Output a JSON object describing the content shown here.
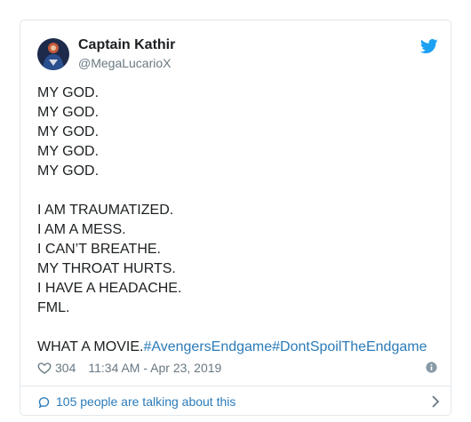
{
  "tweet": {
    "author_name": "Captain Kathir",
    "author_handle": "@MegaLucarioX",
    "lines": [
      "MY GOD.",
      "MY GOD.",
      "MY GOD.",
      "MY GOD.",
      "MY GOD.",
      "",
      "I AM TRAUMATIZED.",
      "I AM A MESS.",
      "I CAN’T BREATHE.",
      "MY THROAT HURTS.",
      "I HAVE A HEADACHE.",
      "FML.",
      ""
    ],
    "last_line_text": "WHAT A MOVIE.",
    "hashtags": [
      "#AvengersEndgame",
      "#DontSpoilTheEndgame"
    ],
    "like_count": "304",
    "timestamp": "11:34 AM - Apr 23, 2019",
    "talking_text": "105 people are talking about this"
  },
  "icons": {
    "brand": "twitter-bird-icon",
    "like": "heart-icon",
    "info": "info-icon",
    "conversation": "speech-bubble-icon",
    "more": "chevron-right-icon"
  },
  "colors": {
    "link": "#2b7bb9",
    "brand": "#1da1f2",
    "text": "#1c2022",
    "muted": "#697882",
    "border": "#e1e8ed"
  }
}
